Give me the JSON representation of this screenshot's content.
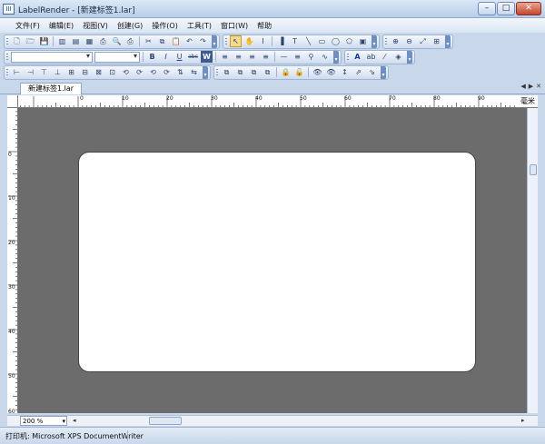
{
  "window": {
    "title": "LabelRender - [新建标签1.lar]",
    "app_icon_glyph": "III",
    "minimize": "–",
    "maximize": "□",
    "close": "✕"
  },
  "menu": [
    "文件(F)",
    "编辑(E)",
    "视图(V)",
    "创建(G)",
    "操作(O)",
    "工具(T)",
    "窗口(W)",
    "帮助"
  ],
  "toolbar": {
    "row1_file": [
      "🗋",
      "🗁",
      "💾",
      "▥",
      "▤",
      "▦",
      "⎙",
      "🔍",
      "⎙",
      "✂",
      "⧉",
      "📋",
      "↶",
      "↷"
    ],
    "row1_draw": [
      "↖",
      "✋",
      "I",
      "▐",
      "T",
      "╲",
      "▭",
      "◯",
      "⬠",
      "▣"
    ],
    "row1_zoom": [
      "⊕",
      "⊖",
      "⤢",
      "⊞"
    ],
    "row2_format": [
      "B",
      "I",
      "U",
      "abc",
      "W"
    ],
    "row2_align": [
      "≡",
      "≡",
      "≡",
      "≡"
    ],
    "row2_misc": [
      "—",
      "≡",
      "⚲",
      "∿"
    ],
    "row2_color": [
      "A",
      "ab",
      "⁄",
      "◈"
    ],
    "row3_layout": [
      "⊢",
      "⊣",
      "⊤",
      "⊥",
      "⊞",
      "⊟",
      "⊠",
      "⊡",
      "⟲",
      "⟳",
      "⟲",
      "⟳",
      "⇅",
      "⇆"
    ],
    "row3_arrange": [
      "⧉",
      "⧉",
      "⧉",
      "⧉",
      "🔒",
      "🔓",
      "👁",
      "👁",
      "↕",
      "⇗",
      "⇘"
    ]
  },
  "tab": {
    "label": "新建标签1.lar",
    "prev": "◀",
    "next": "▶",
    "close": "✕"
  },
  "ruler": {
    "unit": "毫米",
    "h_labels": [
      "0",
      "10",
      "20",
      "30",
      "40",
      "50",
      "60",
      "70",
      "80",
      "90"
    ],
    "v_labels": [
      "0",
      "10",
      "20",
      "30",
      "40",
      "50",
      "60"
    ]
  },
  "zoom": {
    "value": "200 %"
  },
  "status": {
    "printer": "打印机: Microsoft XPS DocumentWriter"
  },
  "colors": {
    "canvas_bg": "#6c6c6c",
    "label_bg": "#ffffff",
    "chrome": "#c9d7ea"
  }
}
